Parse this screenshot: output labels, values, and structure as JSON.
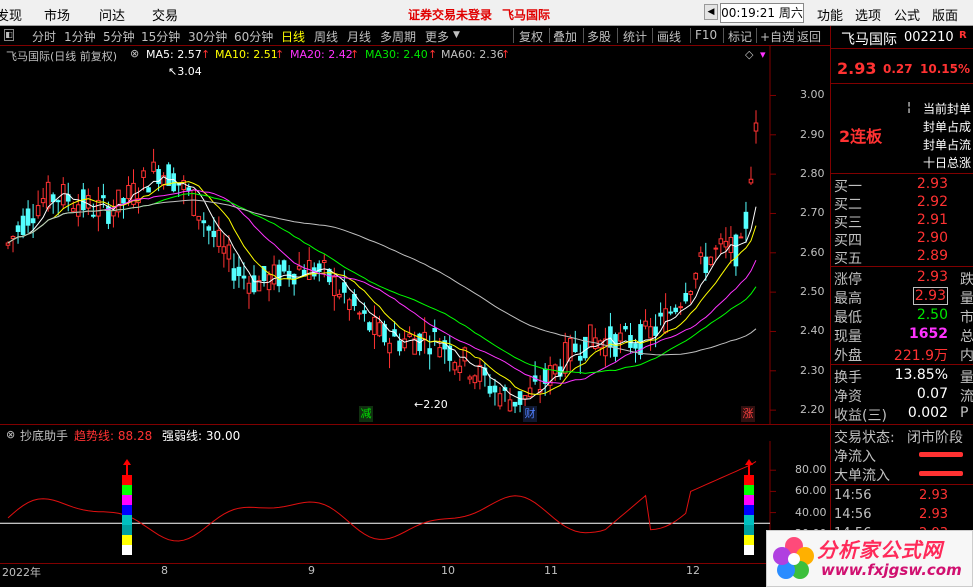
{
  "menubar": {
    "left_items": [
      "发现",
      "市场",
      "问达",
      "交易"
    ],
    "notice": "证券交易未登录",
    "stock_name": "飞马国际",
    "time": "00:19:21 周六",
    "right_items": [
      "功能",
      "选项",
      "公式",
      "版面"
    ]
  },
  "toolbar": {
    "periods": [
      "分时",
      "1分钟",
      "5分钟",
      "15分钟",
      "30分钟",
      "60分钟",
      "日线",
      "周线",
      "月线",
      "多周期",
      "更多"
    ],
    "active_period": "日线",
    "tools": [
      "复权",
      "叠加",
      "多股",
      "统计",
      "画线",
      "F10",
      "标记",
      "+自选",
      "返回"
    ]
  },
  "main_chart": {
    "title": "飞马国际(日线 前复权)",
    "ma": [
      {
        "label": "MA5: 2.57",
        "color": "#ffffff"
      },
      {
        "label": "MA10: 2.51",
        "color": "#ffff00"
      },
      {
        "label": "MA20: 2.42",
        "color": "#ff33ff"
      },
      {
        "label": "MA30: 2.40",
        "color": "#00ff00"
      },
      {
        "label": "MA60: 2.36",
        "color": "#c0c0c0"
      }
    ],
    "high_marker": "3.04",
    "low_marker": "2.20",
    "y_ticks": [
      "3.00",
      "2.90",
      "2.80",
      "2.70",
      "2.60",
      "2.50",
      "2.40",
      "2.30",
      "2.20"
    ],
    "badges": [
      {
        "text": "减",
        "color": "#00c000"
      },
      {
        "text": "财",
        "color": "#3070ff"
      },
      {
        "text": "涨",
        "color": "#ff3232"
      }
    ]
  },
  "indicator": {
    "name": "抄底助手",
    "trend_label": "趋势线: 88.28",
    "strength_label": "强弱线: 30.00",
    "y_ticks": [
      "80.00",
      "60.00",
      "40.00",
      "20.00"
    ]
  },
  "date_axis": [
    "2022年",
    "8",
    "9",
    "10",
    "11",
    "12"
  ],
  "right_panel": {
    "name": "飞马国际",
    "code": "002210",
    "flag": "R",
    "price": "2.93",
    "change": "0.27",
    "change_pct": "10.15%",
    "lianban": "2连板",
    "seal_lines": [
      "当前封单",
      "封单占成",
      "封单占流",
      "十日总涨"
    ],
    "bids": [
      {
        "label": "买一",
        "price": "2.93"
      },
      {
        "label": "买二",
        "price": "2.92"
      },
      {
        "label": "买三",
        "price": "2.91"
      },
      {
        "label": "买四",
        "price": "2.90"
      },
      {
        "label": "买五",
        "price": "2.89"
      }
    ],
    "stats": [
      {
        "label": "涨停",
        "value": "2.93",
        "color": "red",
        "cut": "跌"
      },
      {
        "label": "最高",
        "value": "2.93",
        "color": "red",
        "cut": "量"
      },
      {
        "label": "最低",
        "value": "2.50",
        "color": "green",
        "cut": "市"
      },
      {
        "label": "现量",
        "value": "1652",
        "color": "purple",
        "cut": "总"
      },
      {
        "label": "外盘",
        "value": "221.9万",
        "color": "red",
        "cut": "内"
      }
    ],
    "stats2": [
      {
        "label": "换手",
        "value": "13.85%",
        "color": "white",
        "cut": "量"
      },
      {
        "label": "净资",
        "value": "0.07",
        "color": "white",
        "cut": "流"
      },
      {
        "label": "收益(三)",
        "value": "0.002",
        "color": "white",
        "cut": "P"
      }
    ],
    "status_label": "交易状态:",
    "status_value": "闭市阶段",
    "flows": [
      "净流入",
      "大单流入"
    ],
    "ticks": [
      {
        "time": "14:56",
        "price": "2.93"
      },
      {
        "time": "14:56",
        "price": "2.93"
      },
      {
        "time": "14:56",
        "price": "2.93"
      }
    ]
  },
  "watermark": {
    "title": "分析家公式网",
    "url": "www.fxjgsw.com"
  },
  "chart_data": {
    "type": "line",
    "title": "飞马国际(日线 前复权)",
    "x": [
      "2022-07",
      "2022-08",
      "2022-09",
      "2022-10",
      "2022-11",
      "2022-12"
    ],
    "series": [
      {
        "name": "MA5",
        "values": [
          2.62,
          2.78,
          2.52,
          2.28,
          2.36,
          2.57
        ]
      },
      {
        "name": "MA10",
        "values": [
          2.6,
          2.76,
          2.55,
          2.3,
          2.35,
          2.51
        ]
      },
      {
        "name": "MA20",
        "values": [
          2.58,
          2.72,
          2.62,
          2.38,
          2.34,
          2.42
        ]
      },
      {
        "name": "MA30",
        "values": [
          2.57,
          2.63,
          2.62,
          2.44,
          2.33,
          2.4
        ]
      },
      {
        "name": "MA60",
        "values": [
          2.66,
          2.63,
          2.6,
          2.52,
          2.38,
          2.36
        ]
      }
    ],
    "ylim": [
      2.18,
      3.08
    ],
    "high": 3.04,
    "low": 2.2,
    "last_close": 2.93
  }
}
